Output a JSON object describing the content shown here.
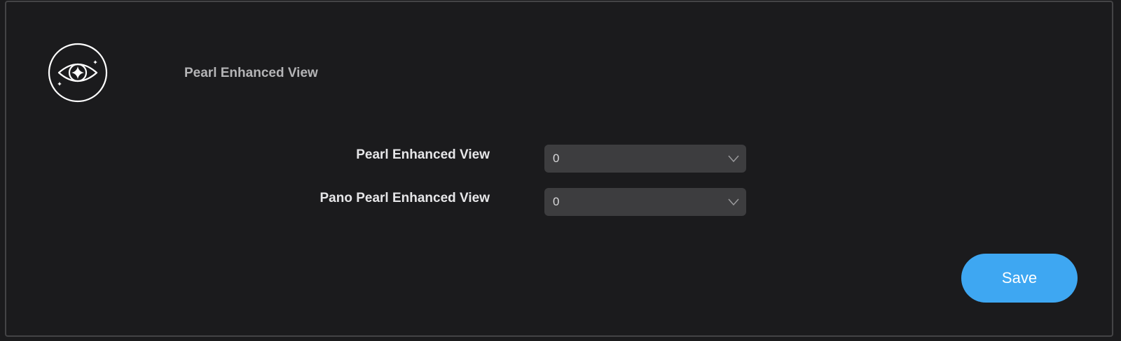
{
  "header": {
    "icon": "sparkle-eye-icon",
    "title": "Pearl Enhanced View"
  },
  "form": {
    "fields": [
      {
        "label": "Pearl Enhanced View",
        "value": "0",
        "icon": "chevron-down-icon"
      },
      {
        "label": "Pano Pearl Enhanced View",
        "value": "0",
        "icon": "chevron-down-icon"
      }
    ]
  },
  "actions": {
    "save_label": "Save"
  },
  "colors": {
    "background": "#1b1b1d",
    "select_background": "#3d3d3f",
    "accent": "#3ea7f2"
  }
}
